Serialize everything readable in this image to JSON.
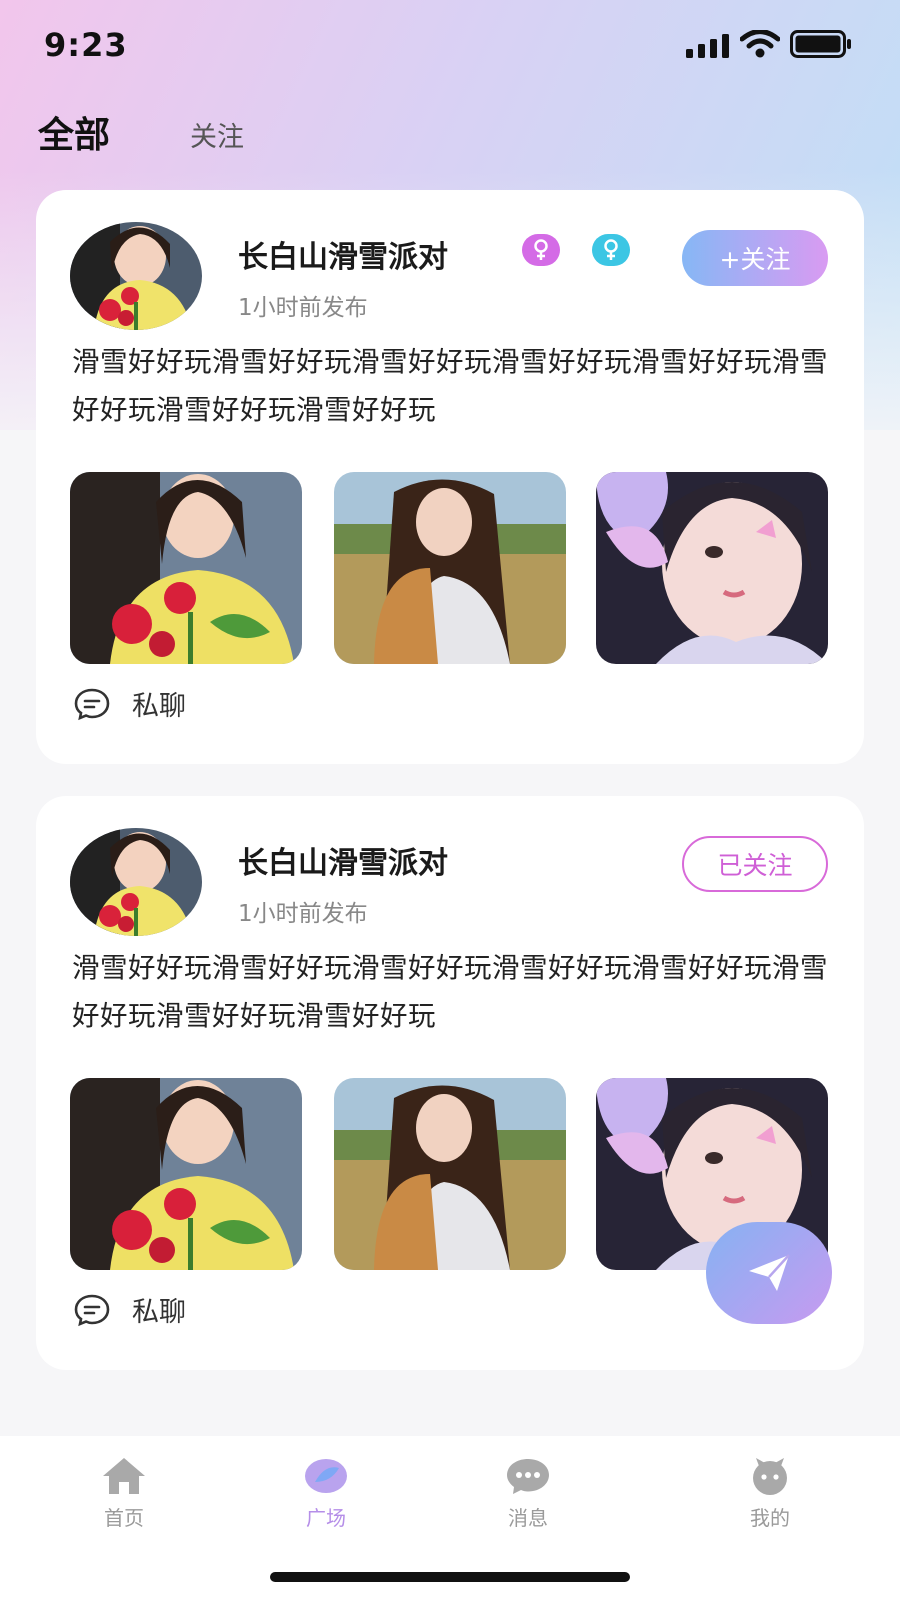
{
  "status_bar": {
    "time": "9:23"
  },
  "top_tabs": {
    "all": "全部",
    "follow": "关注"
  },
  "posts": [
    {
      "author": "长白山滑雪派对",
      "time": "1小时前发布",
      "follow_label": "+关注",
      "text": "滑雪好好玩滑雪好好玩滑雪好好玩滑雪好好玩滑雪好好玩滑雪好好玩滑雪好好玩滑雪好好玩",
      "badges": [
        "female-icon",
        "female-icon"
      ],
      "chat_label": "私聊"
    },
    {
      "author": "长白山滑雪派对",
      "time": "1小时前发布",
      "follow_label": "已关注",
      "text": "滑雪好好玩滑雪好好玩滑雪好好玩滑雪好好玩滑雪好好玩滑雪好好玩滑雪好好玩滑雪好好玩",
      "chat_label": "私聊"
    }
  ],
  "tab_bar": {
    "items": [
      {
        "label": "首页",
        "icon": "home-icon"
      },
      {
        "label": "广场",
        "icon": "plaza-icon",
        "active": true
      },
      {
        "label": "消息",
        "icon": "message-icon"
      },
      {
        "label": "我的",
        "icon": "profile-icon"
      }
    ]
  },
  "colors": {
    "accent": "#b58ee8",
    "follow_gradient_start": "#86b7f5",
    "follow_gradient_end": "#d99bf2",
    "followed_border": "#d86ad9",
    "badge_pink": "#d46be6",
    "badge_cyan": "#3cc6e4"
  }
}
